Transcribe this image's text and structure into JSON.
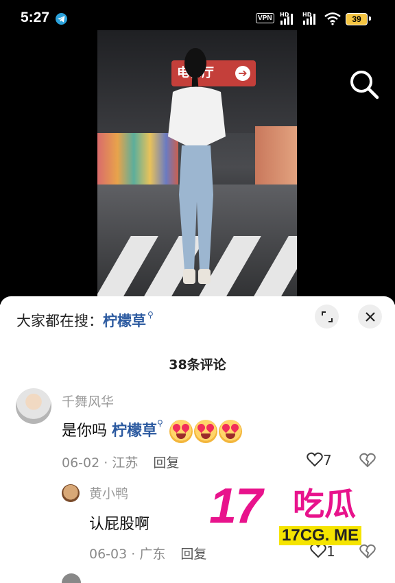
{
  "status_bar": {
    "time": "5:27",
    "vpn": "VPN",
    "signal_label_1": "HD",
    "signal_label_2": "HD",
    "battery": "39"
  },
  "video": {
    "sign_text": "电梯厅",
    "icons": [
      "search-icon",
      "arrow-right-icon"
    ]
  },
  "sheet": {
    "trend_prefix": "大家都在搜：",
    "trend_term": "柠檬草",
    "comment_count": "38条评论",
    "icons": [
      "expand-icon",
      "close-icon"
    ]
  },
  "comments": [
    {
      "username": "千舞风华",
      "text_prefix": "是你吗",
      "text_link": "柠檬草",
      "date": "06-02",
      "location": "江苏",
      "reply_label": "回复",
      "likes": "7"
    },
    {
      "username": "黄小鸭",
      "text": "认屁股啊",
      "date": "06-03",
      "location": "广东",
      "reply_label": "回复",
      "likes": "1"
    }
  ],
  "watermark": {
    "number": "17",
    "text": "吃瓜",
    "url": "17CG. ME"
  },
  "colors": {
    "link": "#2c5aa0",
    "watermark": "#e8138c",
    "watermark_bg": "#f5e400"
  }
}
